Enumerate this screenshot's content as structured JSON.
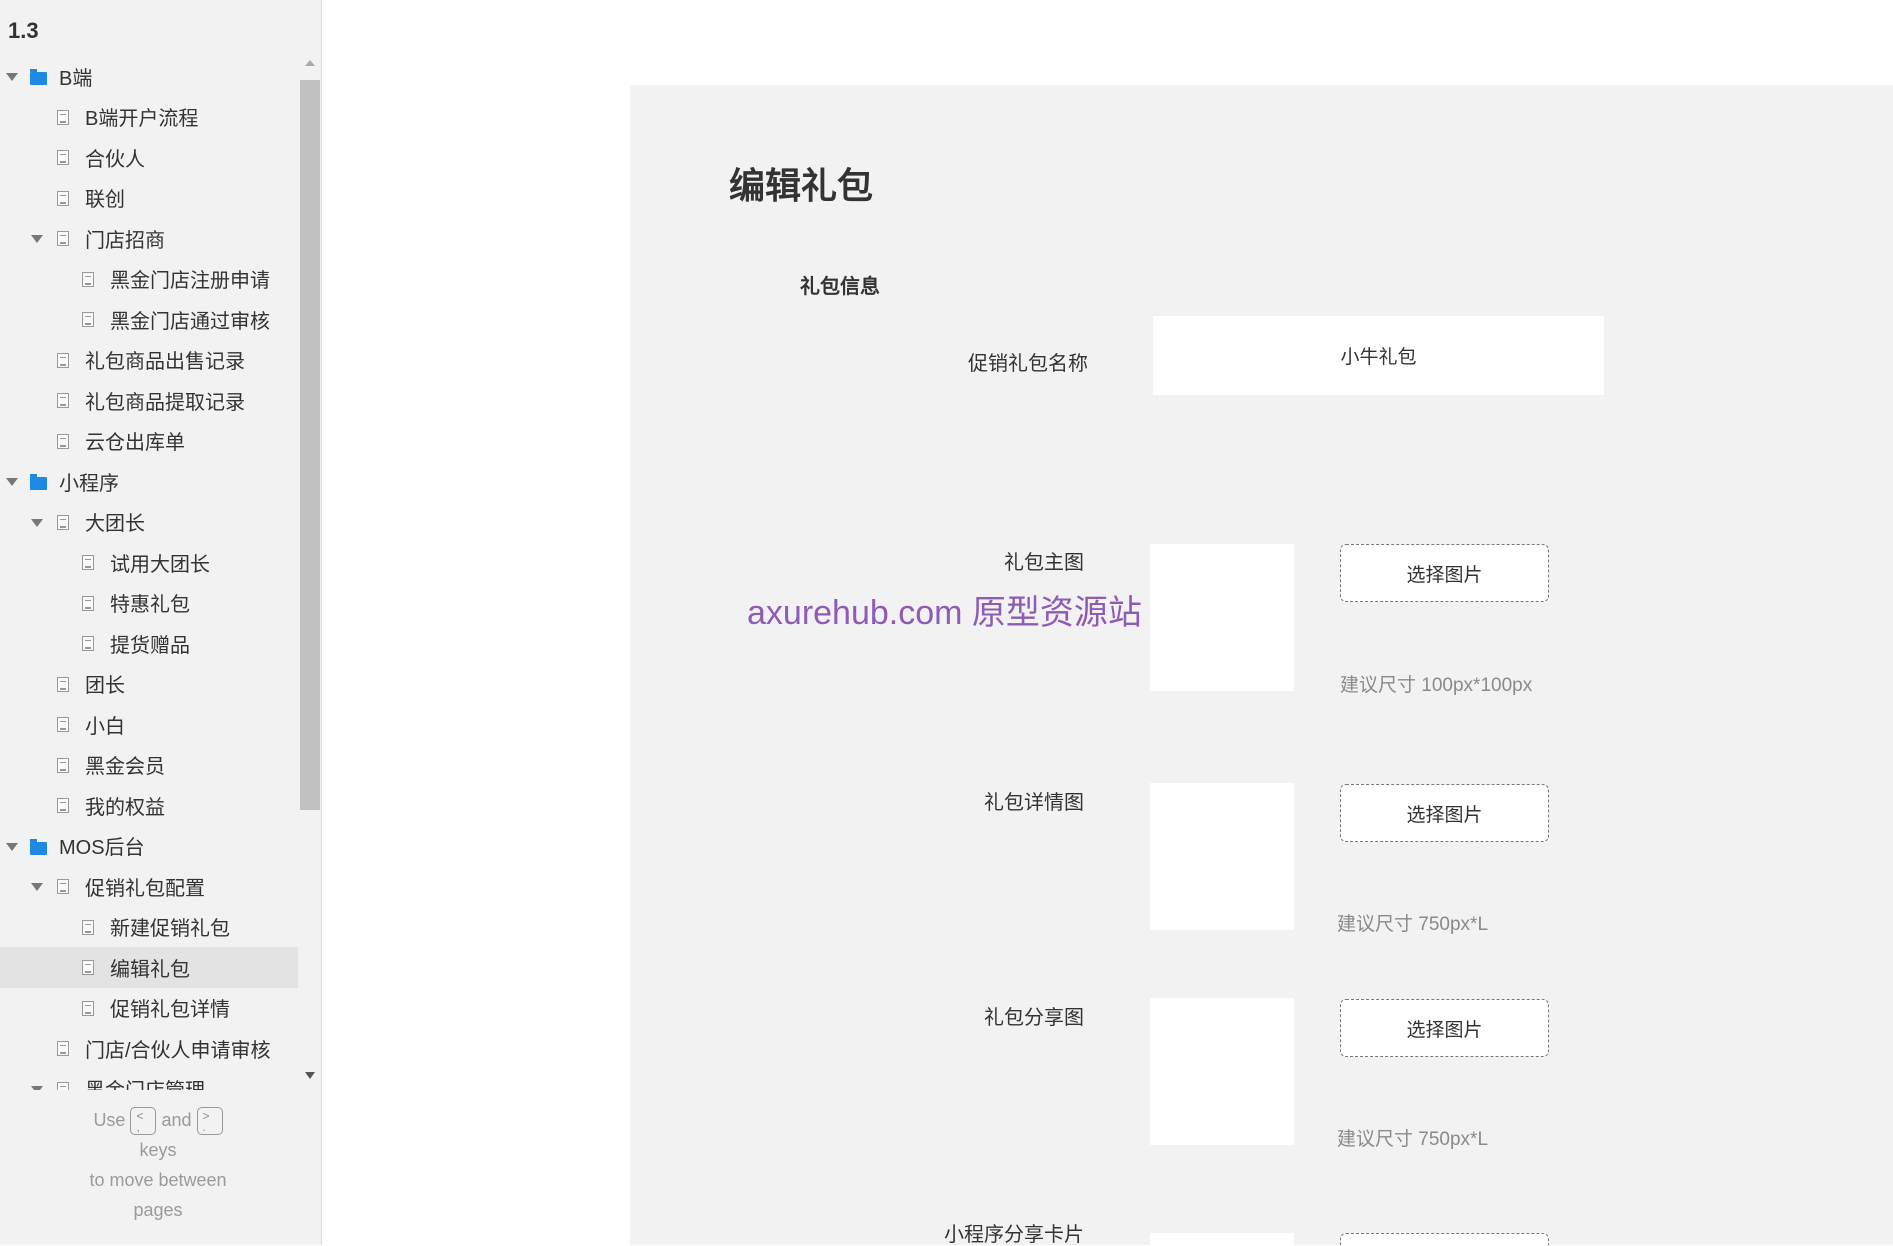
{
  "sidebar": {
    "version": "1.3",
    "items": [
      {
        "label": "B端",
        "type": "folder",
        "level": 0,
        "expanded": true
      },
      {
        "label": "B端开户流程",
        "type": "page",
        "level": 1
      },
      {
        "label": "合伙人",
        "type": "page",
        "level": 1
      },
      {
        "label": "联创",
        "type": "page",
        "level": 1
      },
      {
        "label": "门店招商",
        "type": "page",
        "level": 1,
        "expanded": true
      },
      {
        "label": "黑金门店注册申请",
        "type": "page",
        "level": 2
      },
      {
        "label": "黑金门店通过审核",
        "type": "page",
        "level": 2
      },
      {
        "label": "礼包商品出售记录",
        "type": "page",
        "level": 1
      },
      {
        "label": "礼包商品提取记录",
        "type": "page",
        "level": 1
      },
      {
        "label": "云仓出库单",
        "type": "page",
        "level": 1
      },
      {
        "label": "小程序",
        "type": "folder",
        "level": 0,
        "expanded": true
      },
      {
        "label": "大团长",
        "type": "page",
        "level": 1,
        "expanded": true
      },
      {
        "label": "试用大团长",
        "type": "page",
        "level": 2
      },
      {
        "label": "特惠礼包",
        "type": "page",
        "level": 2
      },
      {
        "label": "提货赠品",
        "type": "page",
        "level": 2
      },
      {
        "label": "团长",
        "type": "page",
        "level": 1
      },
      {
        "label": "小白",
        "type": "page",
        "level": 1
      },
      {
        "label": "黑金会员",
        "type": "page",
        "level": 1
      },
      {
        "label": "我的权益",
        "type": "page",
        "level": 1
      },
      {
        "label": "MOS后台",
        "type": "folder",
        "level": 0,
        "expanded": true
      },
      {
        "label": "促销礼包配置",
        "type": "page",
        "level": 1,
        "expanded": true
      },
      {
        "label": "新建促销礼包",
        "type": "page",
        "level": 2
      },
      {
        "label": "编辑礼包",
        "type": "page",
        "level": 2,
        "selected": true
      },
      {
        "label": "促销礼包详情",
        "type": "page",
        "level": 2
      },
      {
        "label": "门店/合伙人申请审核",
        "type": "page",
        "level": 1
      },
      {
        "label": "黑金门店管理",
        "type": "page",
        "level": 1,
        "expanded": true
      }
    ],
    "hint": {
      "use": "Use",
      "key_prev": "<\n,",
      "and": "and",
      "key_next": ">\n.",
      "keys": "keys",
      "move": "to move between",
      "pages": "pages"
    }
  },
  "main": {
    "title": "编辑礼包",
    "section": "礼包信息",
    "name_label": "促销礼包名称",
    "name_value": "小牛礼包",
    "rows": [
      {
        "label": "礼包主图",
        "button": "选择图片",
        "tip": "建议尺寸 100px*100px"
      },
      {
        "label": "礼包详情图",
        "button": "选择图片",
        "tip": "建议尺寸 750px*L"
      },
      {
        "label": "礼包分享图",
        "button": "选择图片",
        "tip": "建议尺寸 750px*L"
      },
      {
        "label": "小程序分享卡片",
        "button": "",
        "tip": ""
      }
    ],
    "watermark": "axurehub.com 原型资源站"
  },
  "colors": {
    "accent_folder": "#1e88e5",
    "watermark": "#8e5bb5",
    "panel_bg": "#f2f2f2"
  }
}
